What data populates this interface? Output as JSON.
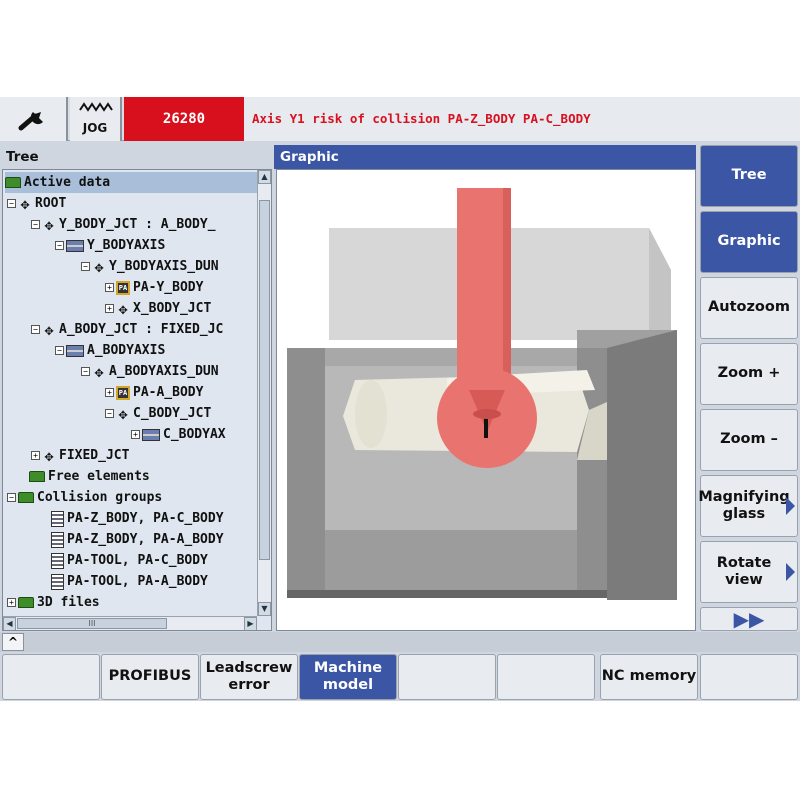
{
  "header": {
    "wrench_icon": "wrench-icon",
    "mode_label": "JOG",
    "alarm_number": "26280",
    "alarm_text": "Axis Y1 risk of collision PA-Z_BODY PA-C_BODY",
    "alarm_color": "#d80f1c"
  },
  "tree": {
    "title": "Tree",
    "rows": [
      {
        "label": "Active data"
      },
      {
        "label": "ROOT"
      },
      {
        "label": "Y_BODY_JCT : A_BODY_"
      },
      {
        "label": "Y_BODYAXIS"
      },
      {
        "label": "Y_BODYAXIS_DUN"
      },
      {
        "label": "PA-Y_BODY"
      },
      {
        "label": "X_BODY_JCT"
      },
      {
        "label": "A_BODY_JCT : FIXED_JC"
      },
      {
        "label": "A_BODYAXIS"
      },
      {
        "label": "A_BODYAXIS_DUN"
      },
      {
        "label": "PA-A_BODY"
      },
      {
        "label": "C_BODY_JCT"
      },
      {
        "label": "C_BODYAX"
      },
      {
        "label": "FIXED_JCT"
      },
      {
        "label": "Free elements"
      },
      {
        "label": "Collision groups"
      },
      {
        "label": "PA-Z_BODY, PA-C_BODY"
      },
      {
        "label": "PA-Z_BODY, PA-A_BODY"
      },
      {
        "label": "PA-TOOL, PA-C_BODY"
      },
      {
        "label": "PA-TOOL, PA-A_BODY"
      },
      {
        "label": "3D files"
      }
    ],
    "hscroll_label": "III"
  },
  "graphic": {
    "title": "Graphic",
    "collision_color": "#e9736e"
  },
  "vertical_softkeys": [
    {
      "label": "Tree"
    },
    {
      "label": "Graphic"
    },
    {
      "label": "Autozoom"
    },
    {
      "label": "Zoom +"
    },
    {
      "label": "Zoom –"
    },
    {
      "label": "Magnifying glass"
    },
    {
      "label": "Rotate view"
    },
    {
      "label": "▶▶"
    }
  ],
  "horizontal_softkeys": [
    {
      "label": ""
    },
    {
      "label": "PROFIBUS"
    },
    {
      "label": "Leadscrew error"
    },
    {
      "label": "Machine model"
    },
    {
      "label": ""
    },
    {
      "label": ""
    },
    {
      "label": "NC memory"
    },
    {
      "label": ""
    }
  ],
  "accent_color": "#3a56a4"
}
